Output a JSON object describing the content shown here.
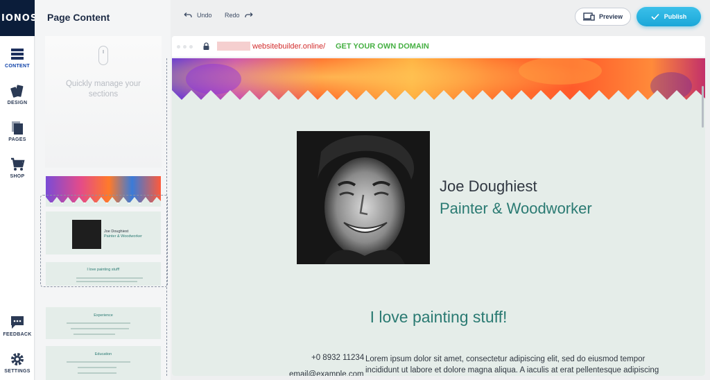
{
  "brand": "IONOS",
  "rail": {
    "items": [
      {
        "label": "CONTENT",
        "icon": "content-icon",
        "active": true
      },
      {
        "label": "DESIGN",
        "icon": "design-icon",
        "active": false
      },
      {
        "label": "PAGES",
        "icon": "pages-icon",
        "active": false
      },
      {
        "label": "SHOP",
        "icon": "cart-icon",
        "active": false
      },
      {
        "label": "FEEDBACK",
        "icon": "chat-icon",
        "active": false
      },
      {
        "label": "SETTINGS",
        "icon": "gear-icon",
        "active": false
      }
    ]
  },
  "panel": {
    "title": "Page Content",
    "hint": "Quickly manage your sections",
    "thumbs": {
      "hero_name": "Joe Doughiest",
      "hero_job": "Painter & Woodworker",
      "intro_title": "I love painting stuff!",
      "experience_title": "Experience",
      "education_title": "Education"
    }
  },
  "toolbar": {
    "undo": "Undo",
    "redo": "Redo",
    "preview": "Preview",
    "publish": "Publish"
  },
  "browser": {
    "url": "websitebuilder.online/",
    "domain_cta": "GET YOUR OWN DOMAIN"
  },
  "site": {
    "name": "Joe Doughiest",
    "job": "Painter & Woodworker",
    "heading": "I love painting stuff!",
    "phone": "+0 8932 11234",
    "email": "email@example.com",
    "body": "Lorem ipsum dolor sit amet, consectetur adipiscing elit, sed do eiusmod tempor incididunt ut labore et dolore magna aliqua. A iaculis at erat pellentesque adipiscing"
  },
  "colors": {
    "accent": "#1aa7d8",
    "brand_dark": "#0b1d3a",
    "teal": "#2a7a72",
    "url_red": "#d22c2c",
    "cta_green": "#46b043"
  }
}
